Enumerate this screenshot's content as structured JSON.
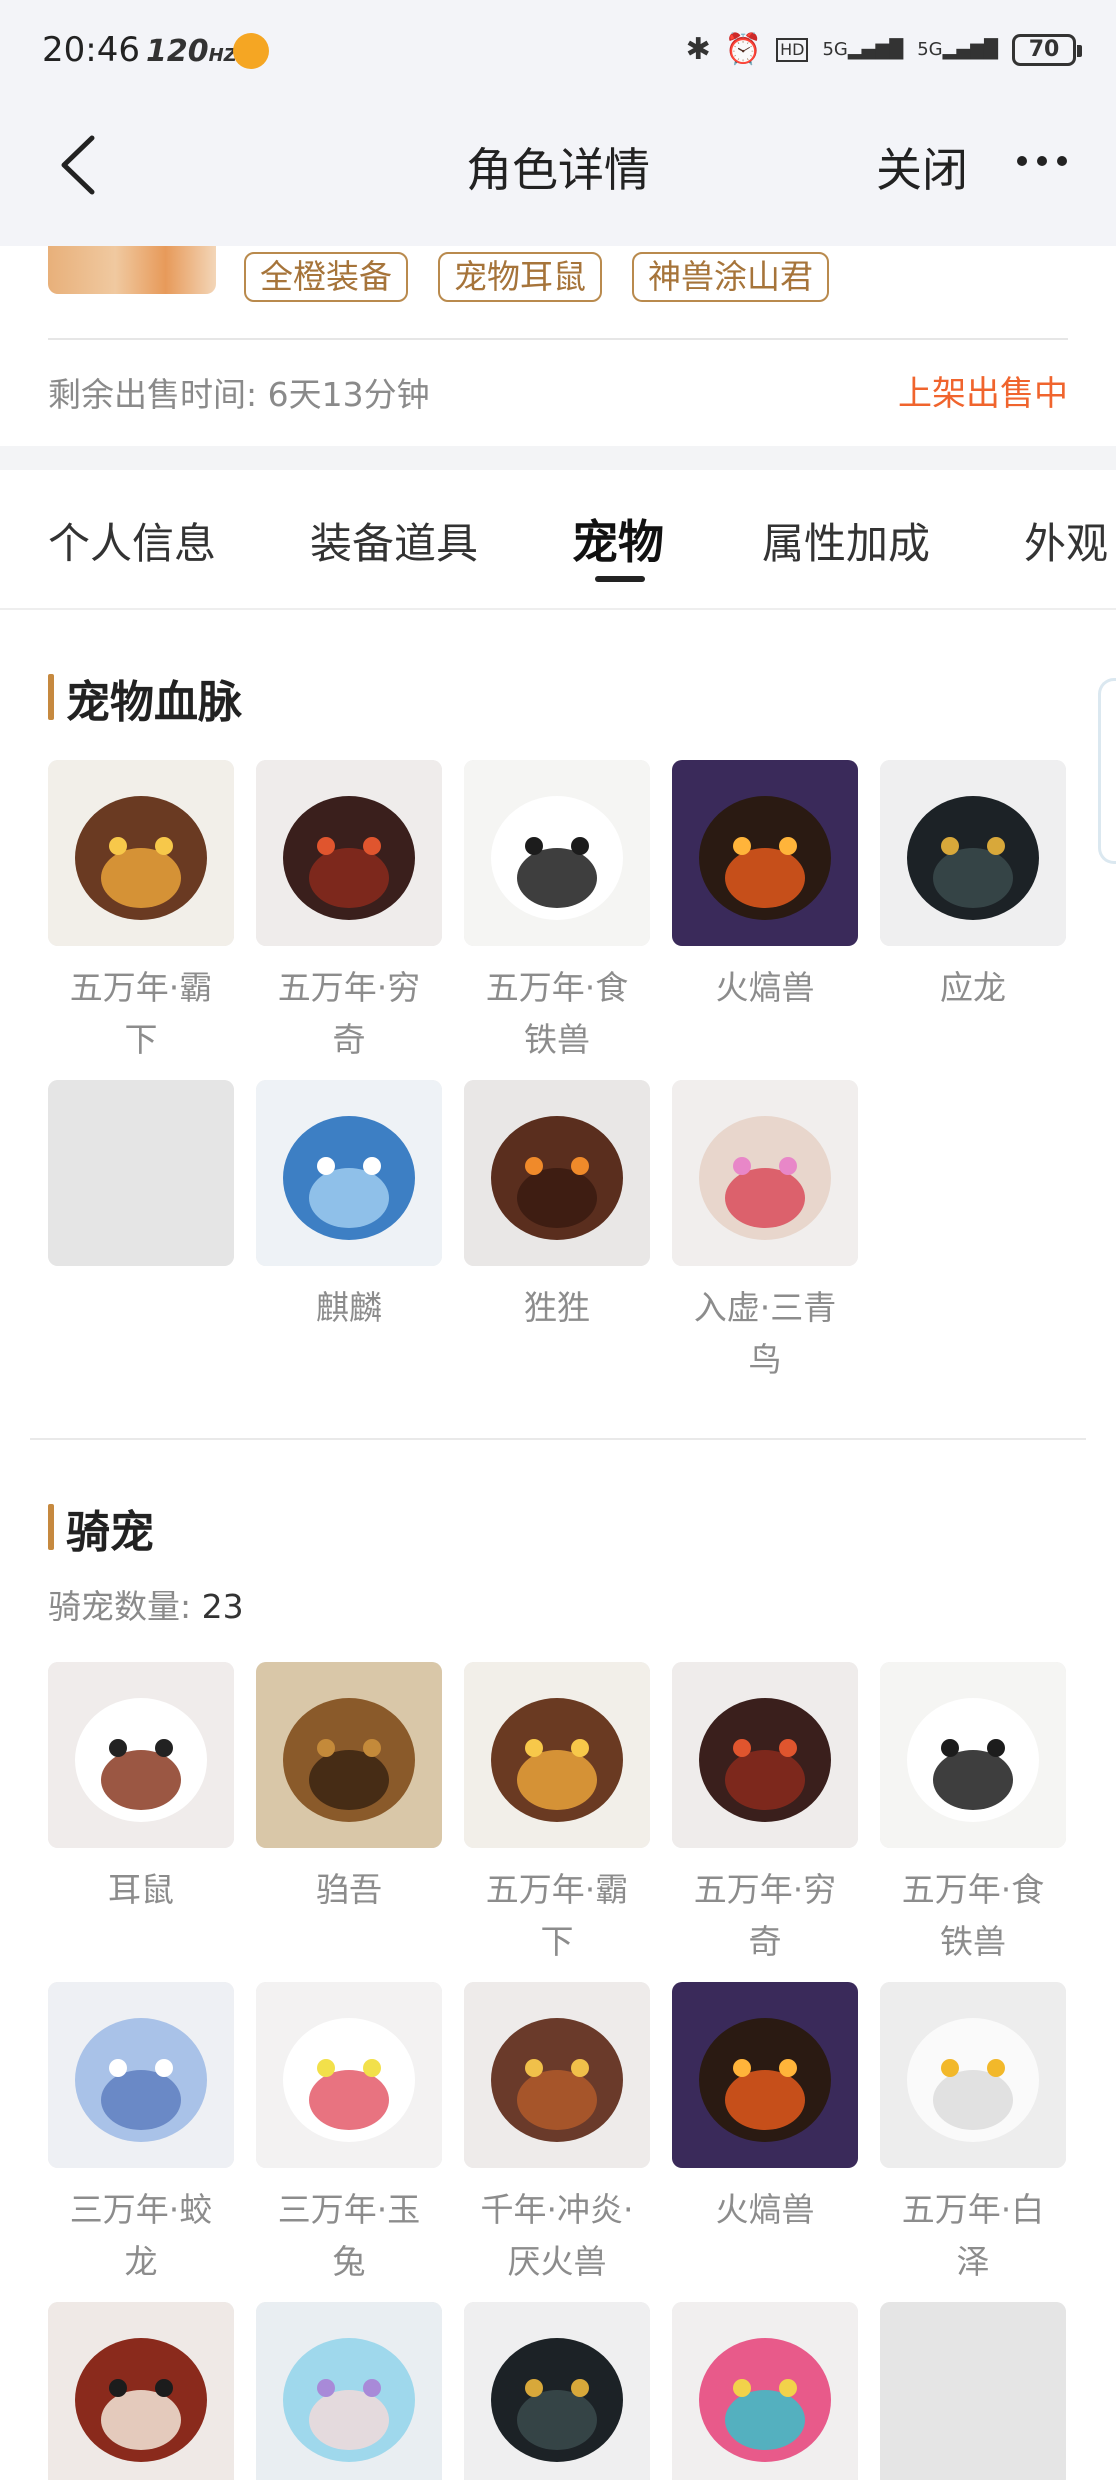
{
  "status_bar": {
    "time": "20:46",
    "refresh_rate": "120",
    "refresh_unit": "HZ",
    "network_1": "5G",
    "network_2": "5G",
    "hd_label": "HD",
    "battery": "70"
  },
  "nav": {
    "title": "角色详情",
    "close_label": "关闭"
  },
  "card": {
    "tags": [
      "全橙装备",
      "宠物耳鼠",
      "神兽涂山君"
    ],
    "remaining_time": "剩余出售时间: 6天13分钟",
    "status": "上架出售中"
  },
  "tabs": [
    "个人信息",
    "装备道具",
    "宠物",
    "属性加成",
    "外观"
  ],
  "active_tab": "宠物",
  "bloodline": {
    "title": "宠物血脉",
    "pets": [
      {
        "name": "五万年·霸下",
        "icon": "dragon-gold-portrait"
      },
      {
        "name": "五万年·穷奇",
        "icon": "dark-beast-portrait"
      },
      {
        "name": "五万年·食铁兽",
        "icon": "panda-portrait"
      },
      {
        "name": "火熇兽",
        "icon": "fire-beast-portrait"
      },
      {
        "name": "应龙",
        "icon": "black-dragon-portrait"
      },
      {
        "name": "",
        "icon": "empty-slot"
      },
      {
        "name": "麒麟",
        "icon": "blue-qilin-portrait"
      },
      {
        "name": "狌狌",
        "icon": "ape-portrait"
      },
      {
        "name": "入虚·三青鸟",
        "icon": "three-maidens-portrait"
      }
    ]
  },
  "mounts": {
    "title": "骑宠",
    "count_label": "骑宠数量:",
    "count": "23",
    "pets": [
      {
        "name": "耳鼠",
        "icon": "mouse-portrait"
      },
      {
        "name": "驺吾",
        "icon": "lion-beast-portrait"
      },
      {
        "name": "五万年·霸下",
        "icon": "dragon-gold-portrait"
      },
      {
        "name": "五万年·穷奇",
        "icon": "dark-beast-portrait"
      },
      {
        "name": "五万年·食铁兽",
        "icon": "panda-portrait"
      },
      {
        "name": "三万年·蛟龙",
        "icon": "ice-dragon-portrait"
      },
      {
        "name": "三万年·玉兔",
        "icon": "white-rabbit-portrait"
      },
      {
        "name": "千年·冲炎·厌火兽",
        "icon": "fire-wolf-portrait"
      },
      {
        "name": "火熇兽",
        "icon": "fire-beast-portrait"
      },
      {
        "name": "五万年·白泽",
        "icon": "white-cat-portrait"
      },
      {
        "name": "",
        "icon": "red-squirrel-portrait"
      },
      {
        "name": "",
        "icon": "crystal-maiden-portrait"
      },
      {
        "name": "",
        "icon": "black-dragon-portrait"
      },
      {
        "name": "",
        "icon": "phoenix-portrait"
      },
      {
        "name": "",
        "icon": "empty-slot"
      }
    ]
  },
  "colors": {
    "accent_bar": "#c6893f",
    "tag_border": "#b98a4d",
    "status_orange": "#f0642d",
    "nav_bg": "#f3f4f8"
  }
}
